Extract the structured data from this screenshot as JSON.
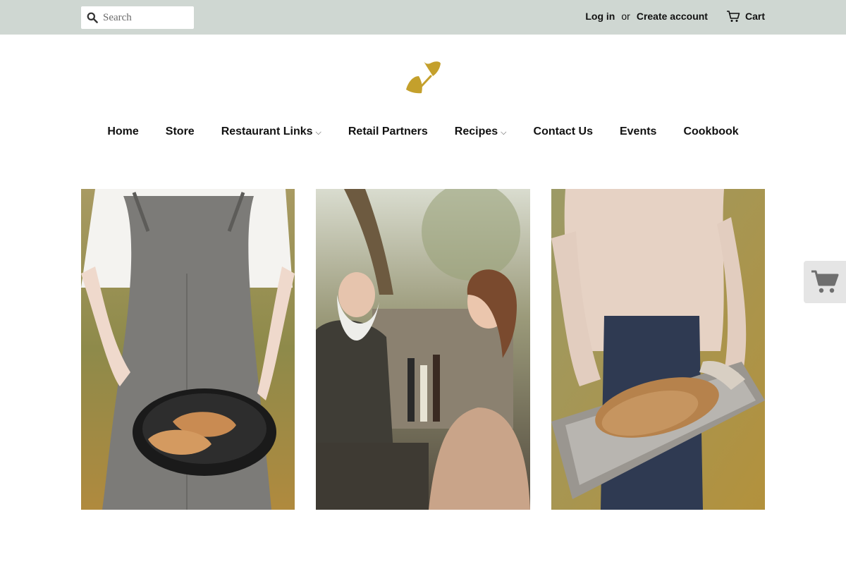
{
  "header": {
    "search_placeholder": "Search",
    "login_label": "Log in",
    "or_text": "or",
    "create_account_label": "Create account",
    "cart_label": "Cart"
  },
  "brand": {
    "logo_icon": "leaf-logo-icon",
    "logo_color": "#c4a02c"
  },
  "nav": {
    "home": "Home",
    "store": "Store",
    "restaurant_links": "Restaurant Links",
    "retail_partners": "Retail Partners",
    "recipes": "Recipes",
    "contact_us": "Contact Us",
    "events": "Events",
    "cookbook": "Cookbook",
    "dropdown_caret": "⌵"
  },
  "gallery": [
    {
      "subject": "chef in apron holding cast-iron skillet with seared duck breasts"
    },
    {
      "subject": "bearded man and woman laughing with glasses of red wine outdoors"
    },
    {
      "subject": "person in apron holding roasted duck on rack in sheet pan"
    }
  ],
  "floating_cart": {
    "icon": "shopping-cart-icon"
  },
  "theme": {
    "topbar": "#cfd7d2",
    "accent": "#c4a02c"
  }
}
